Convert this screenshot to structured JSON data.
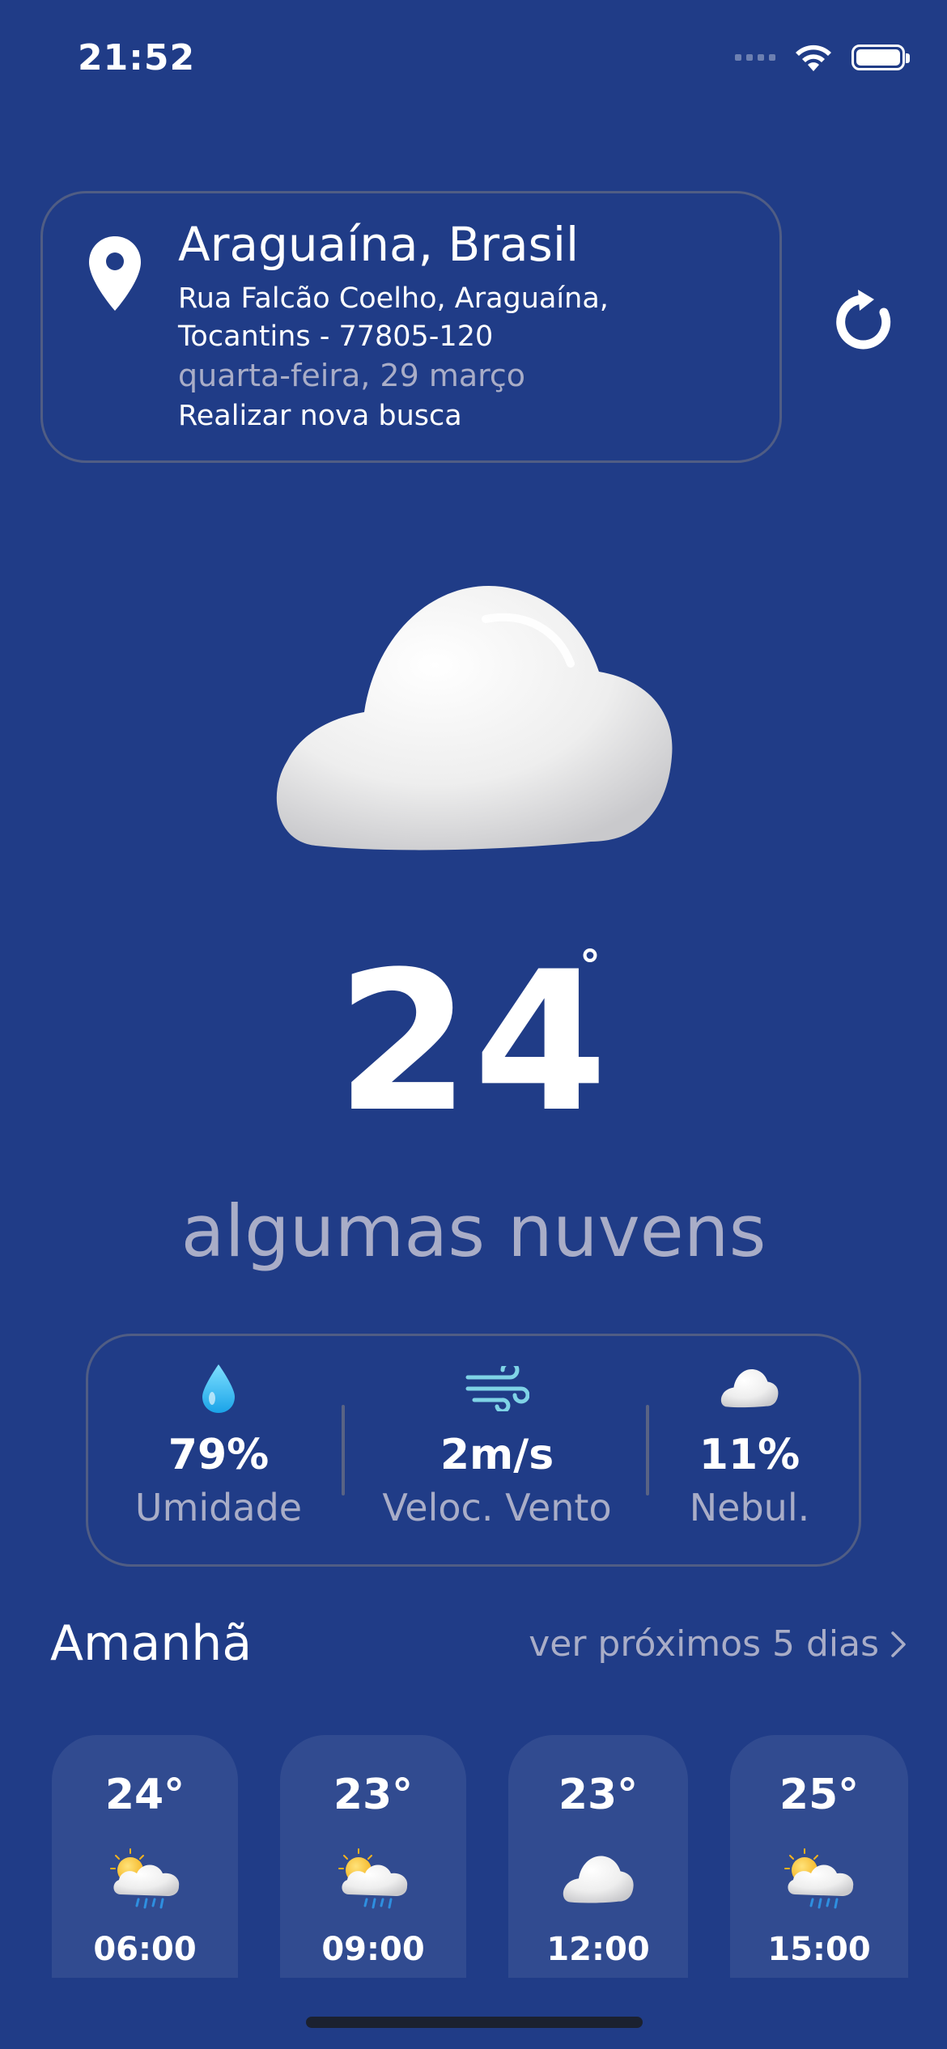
{
  "status_bar": {
    "time": "21:52"
  },
  "location": {
    "city": "Araguaína, Brasil",
    "address": "Rua Falcão Coelho, Araguaína, Tocantins - 77805-120",
    "date": "quarta-feira, 29 março",
    "search_link": "Realizar nova busca"
  },
  "current": {
    "temperature": "24",
    "degree_symbol": "°",
    "description": "algumas nuvens",
    "icon": "cloud-icon"
  },
  "stats": [
    {
      "value": "79%",
      "label": "Umidade",
      "icon": "water-drop-icon"
    },
    {
      "value": "2m/s",
      "label": "Veloc. Vento",
      "icon": "wind-icon"
    },
    {
      "value": "11%",
      "label": "Nebul.",
      "icon": "cloud-icon"
    }
  ],
  "tomorrow": {
    "title": "Amanhã",
    "next_days_link": "ver próximos 5 dias",
    "hours": [
      {
        "temp": "24°",
        "time": "06:00",
        "icon": "sun-cloud-rain-icon"
      },
      {
        "temp": "23°",
        "time": "09:00",
        "icon": "sun-cloud-rain-icon"
      },
      {
        "temp": "23°",
        "time": "12:00",
        "icon": "cloud-icon"
      },
      {
        "temp": "25°",
        "time": "15:00",
        "icon": "sun-cloud-rain-icon"
      }
    ]
  },
  "colors": {
    "background": "#203c87",
    "muted_text": "#a9adc7",
    "card_border": "#6b6e7e"
  }
}
